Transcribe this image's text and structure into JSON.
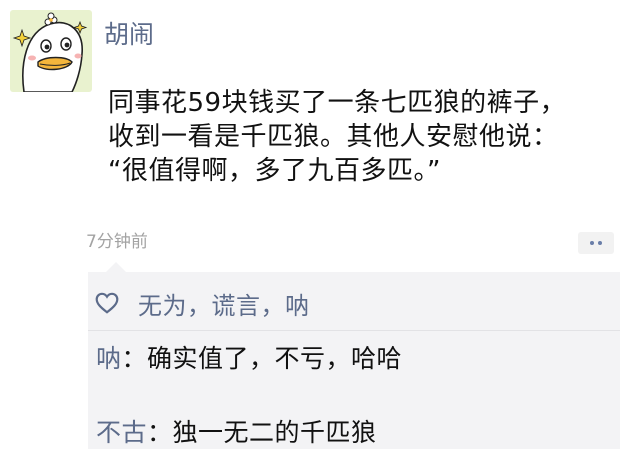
{
  "post": {
    "username": "胡闹",
    "content_lines": [
      "同事花59块钱买了一条七匹狼的裤子，",
      "收到一看是千匹狼。其他人安慰他说：",
      "“很值得啊，多了九百多匹。”"
    ],
    "timestamp": "7分钟前"
  },
  "interactions": {
    "likes_text": "无为，谎言，呐",
    "comments": [
      {
        "author": "呐",
        "separator": "：",
        "text": "确实值了，不亏，哈哈"
      },
      {
        "author": "不古",
        "separator": "：",
        "text": "独一无二的千匹狼"
      }
    ]
  },
  "colors": {
    "name_blue": "#5c6b8a",
    "text": "#111111",
    "meta_gray": "#a3a3a3",
    "comment_bg": "#f3f3f5",
    "avatar_bg": "#e9f2cf"
  },
  "icons": {
    "avatar": "duck-cartoon-avatar",
    "like": "heart-outline-icon",
    "more": "more-dots-icon"
  }
}
